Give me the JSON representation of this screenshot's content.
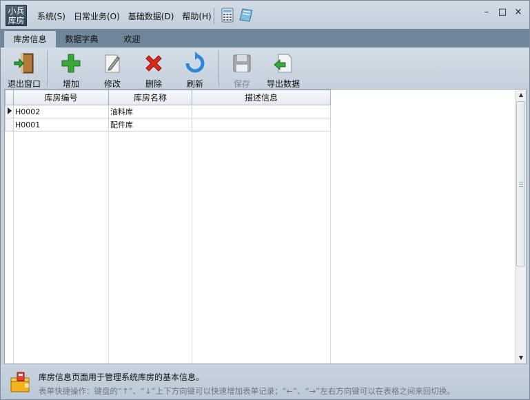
{
  "app": {
    "logo_line1": "小兵",
    "logo_line2": "库房"
  },
  "menu": [
    {
      "label": "系统(S)"
    },
    {
      "label": "日常业务(O)"
    },
    {
      "label": "基础数据(D)"
    },
    {
      "label": "帮助(H)"
    }
  ],
  "window_controls": {
    "minimize": "–",
    "maximize": "□",
    "close": "×"
  },
  "tabs": [
    {
      "label": "库房信息",
      "active": true
    },
    {
      "label": "数据字典",
      "active": false
    },
    {
      "label": "欢迎",
      "active": false
    }
  ],
  "toolbar": {
    "exit": "退出窗口",
    "add": "增加",
    "edit": "修改",
    "delete": "删除",
    "refresh": "刷新",
    "save": "保存",
    "export": "导出数据"
  },
  "grid": {
    "columns": [
      "库房编号",
      "库房名称",
      "描述信息"
    ],
    "rows": [
      [
        "H0002",
        "油料库",
        ""
      ],
      [
        "H0001",
        "配件库",
        ""
      ]
    ]
  },
  "footer": {
    "message": "库房信息页面用于管理系统库房的基本信息。",
    "hint": "表单快捷操作：键盘的“↑”、“↓”上下方向键可以快速增加表单记录；“←”、“→”左右方向键可以在表格之间来回切换。"
  },
  "colors": {
    "add": "#3aa839",
    "delete": "#d92a1c",
    "refresh": "#2f86d6",
    "tab_active": "#c6d3df",
    "tabbar": "#6f8598"
  }
}
